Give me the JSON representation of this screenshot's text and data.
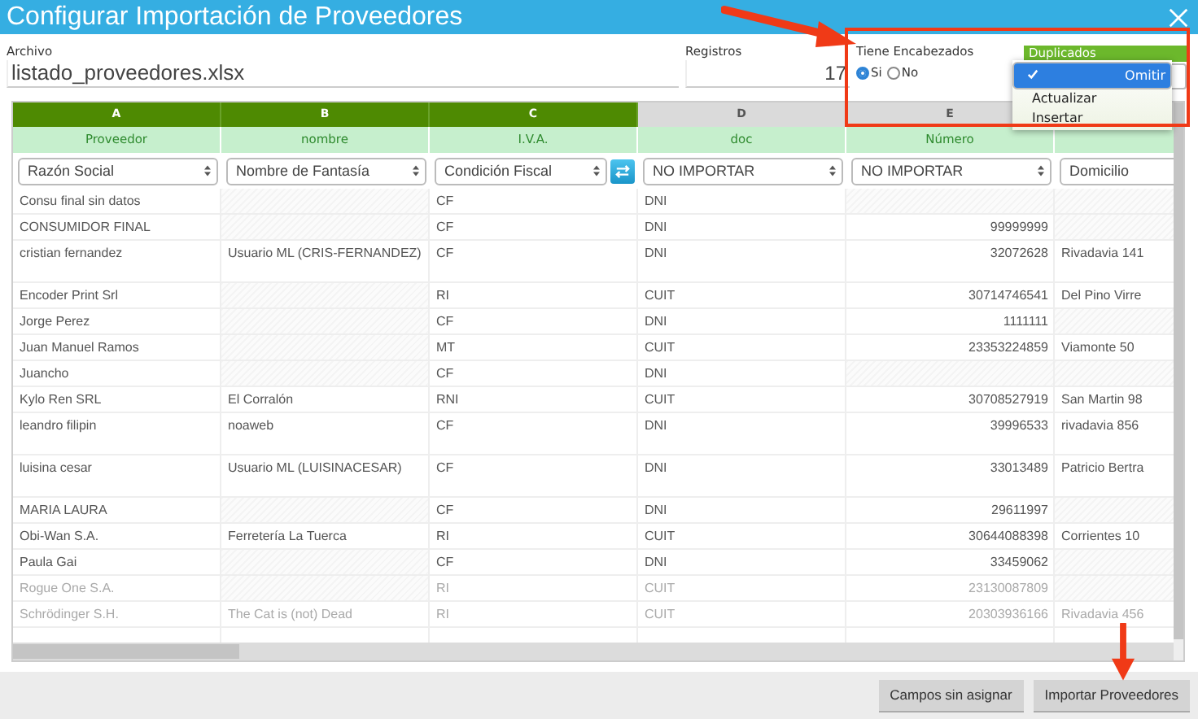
{
  "window": {
    "title": "Configurar Importación de Proveedores"
  },
  "file": {
    "label": "Archivo",
    "value": "listado_proveedores.xlsx"
  },
  "records": {
    "label": "Registros",
    "value": "17"
  },
  "headers": {
    "label": "Tiene Encabezados",
    "options": [
      {
        "label": "Si",
        "selected": true
      },
      {
        "label": "No",
        "selected": false
      }
    ]
  },
  "duplicates": {
    "label": "Duplicados",
    "options": [
      {
        "label": "Omitir",
        "selected": true
      },
      {
        "label": "Actualizar",
        "selected": false
      },
      {
        "label": "Insertar",
        "selected": false
      }
    ]
  },
  "table": {
    "columns": [
      {
        "letter": "A",
        "header": "Proveedor",
        "mapped": true,
        "field": "Razón Social"
      },
      {
        "letter": "B",
        "header": "nombre",
        "mapped": true,
        "field": "Nombre de Fantasía"
      },
      {
        "letter": "C",
        "header": "I.V.A.",
        "mapped": true,
        "field": "Condición Fiscal",
        "swap": true
      },
      {
        "letter": "D",
        "header": "doc",
        "mapped": false,
        "field": "NO IMPORTAR"
      },
      {
        "letter": "E",
        "header": "Número",
        "mapped": false,
        "field": "NO IMPORTAR"
      },
      {
        "mapped": false,
        "field": "Domicilio"
      }
    ],
    "rows": [
      {
        "tall": false,
        "faded": false,
        "cells": [
          "Consu final sin datos",
          null,
          "CF",
          "DNI",
          null,
          null
        ]
      },
      {
        "tall": false,
        "faded": false,
        "cells": [
          "CONSUMIDOR FINAL",
          null,
          "CF",
          "DNI",
          "99999999",
          null
        ]
      },
      {
        "tall": true,
        "faded": false,
        "cells": [
          "cristian fernandez",
          "Usuario ML (CRIS-FERNANDEZ)",
          "CF",
          "DNI",
          "32072628",
          "Rivadavia 141"
        ]
      },
      {
        "tall": false,
        "faded": false,
        "cells": [
          "Encoder Print Srl",
          null,
          "RI",
          "CUIT",
          "30714746541",
          "Del Pino Virre"
        ]
      },
      {
        "tall": false,
        "faded": false,
        "cells": [
          "Jorge Perez",
          null,
          "CF",
          "DNI",
          "1111111",
          null
        ]
      },
      {
        "tall": false,
        "faded": false,
        "cells": [
          "Juan Manuel Ramos",
          null,
          "MT",
          "CUIT",
          "23353224859",
          "Viamonte 50"
        ]
      },
      {
        "tall": false,
        "faded": false,
        "cells": [
          "Juancho",
          null,
          "CF",
          "DNI",
          null,
          null
        ]
      },
      {
        "tall": false,
        "faded": false,
        "cells": [
          "Kylo Ren SRL",
          "El Corralón",
          "RNI",
          "CUIT",
          "30708527919",
          "San Martin 98"
        ]
      },
      {
        "tall": true,
        "faded": false,
        "cells": [
          "leandro filipin",
          "noaweb",
          "CF",
          "DNI",
          "39996533",
          "rivadavia 856"
        ]
      },
      {
        "tall": true,
        "faded": false,
        "cells": [
          "luisina cesar",
          "Usuario ML (LUISINACESAR)",
          "CF",
          "DNI",
          "33013489",
          "Patricio Bertra"
        ]
      },
      {
        "tall": false,
        "faded": false,
        "cells": [
          "MARIA LAURA",
          null,
          "CF",
          "DNI",
          "29611997",
          null
        ]
      },
      {
        "tall": false,
        "faded": false,
        "cells": [
          "Obi-Wan S.A.",
          "Ferretería La Tuerca",
          "RI",
          "CUIT",
          "30644088398",
          "Corrientes 10"
        ]
      },
      {
        "tall": false,
        "faded": false,
        "cells": [
          "Paula Gai",
          null,
          "CF",
          "DNI",
          "33459062",
          null
        ]
      },
      {
        "tall": false,
        "faded": true,
        "cells": [
          "Rogue One S.A.",
          null,
          "RI",
          "CUIT",
          "23130087809",
          null
        ]
      },
      {
        "tall": false,
        "faded": true,
        "cells": [
          "Schrödinger S.H.",
          "The Cat is (not) Dead",
          "RI",
          "CUIT",
          "20303936166",
          "Rivadavia 456"
        ]
      }
    ]
  },
  "buttons": [
    "Campos sin asignar",
    "Importar Proveedores"
  ]
}
